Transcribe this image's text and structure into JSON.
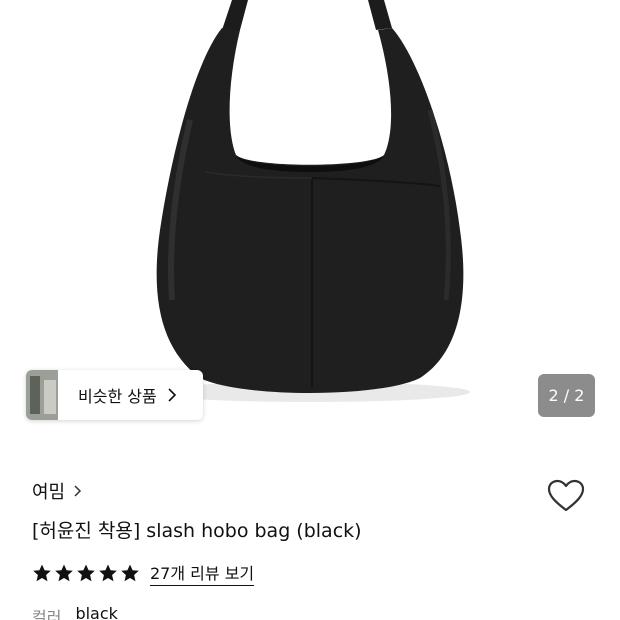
{
  "gallery": {
    "similar_label": "비슷한 상품",
    "page_indicator": "2 / 2"
  },
  "product": {
    "brand": "여밈",
    "title": "[허윤진 착용] slash hobo bag (black)",
    "rating_stars": 5,
    "review_link": "27개 리뷰 보기",
    "option_label": "컬러",
    "option_value": "black"
  },
  "icons": {
    "similar_chevron": "chevron-right-icon",
    "brand_chevron": "chevron-right-icon",
    "wishlist": "heart-outline-icon",
    "star": "star-filled-icon"
  },
  "colors": {
    "text": "#111111",
    "muted": "#888888",
    "indicator_bg": "#787878"
  }
}
